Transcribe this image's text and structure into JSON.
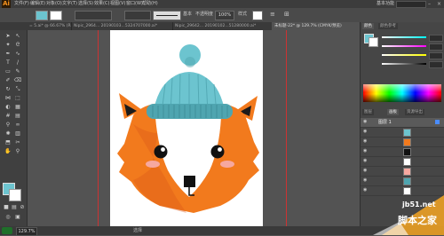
{
  "app": {
    "logo": "Ai",
    "workspace": "基本功能"
  },
  "menubar": {
    "items": [
      "文件(F)",
      "编辑(E)",
      "对象(O)",
      "文字(T)",
      "选择(S)",
      "效果(C)",
      "视图(V)",
      "窗口(W)",
      "帮助(H)"
    ]
  },
  "control_bar": {
    "style_label": "基本",
    "opacity_label": "不透明度",
    "opacity_value": "100%",
    "style_word": "样式"
  },
  "tabs": [
    {
      "label": "= 5.ai* @ 66.67% (RGB/...",
      "active": false
    },
    {
      "label": "Nipic_2964... 20190103...5324707000.ai*",
      "active": false
    },
    {
      "label": "Nipic_29642... 20190102...51280000.ai*",
      "active": false
    },
    {
      "label": "未标题-22* @ 129.7% (CMYK/预览)",
      "active": true
    }
  ],
  "status": {
    "zoom": "129.7%",
    "label": "选择"
  },
  "colors": {
    "fox_orange": "#f27a1d",
    "fox_dark": "#d9551a",
    "hat_teal": "#6cc4cf",
    "hat_dark": "#4fa5b0",
    "cheek": "#f6a8a0"
  },
  "panels": {
    "color_tabs": [
      "颜色",
      "颜色参考"
    ],
    "layer_tabs": [
      "图层",
      "画板",
      "资源导出"
    ],
    "layer_label": "图层 1",
    "color_values": [
      "",
      "",
      "",
      ""
    ]
  },
  "watermark": {
    "site": "jb51.net",
    "brand": "脚本之家"
  }
}
